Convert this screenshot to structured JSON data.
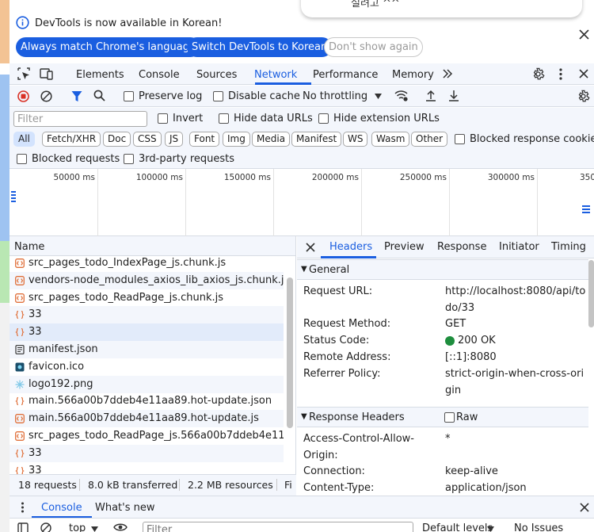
{
  "popup": {
    "text": "설려고 ^^"
  },
  "infobar": {
    "message": "DevTools is now available in Korean!",
    "btn_match": "Always match Chrome's language",
    "btn_switch": "Switch DevTools to Korean",
    "btn_dismiss": "Don't show again"
  },
  "tabs": [
    "Elements",
    "Console",
    "Sources",
    "Network",
    "Performance",
    "Memory"
  ],
  "netbar": {
    "preserve_log": "Preserve log",
    "disable_cache": "Disable cache",
    "throttling": "No throttling"
  },
  "filterbar": {
    "placeholder": "Filter",
    "invert": "Invert",
    "hide_data": "Hide data URLs",
    "hide_ext": "Hide extension URLs"
  },
  "types": [
    "All",
    "Fetch/XHR",
    "Doc",
    "CSS",
    "JS",
    "Font",
    "Img",
    "Media",
    "Manifest",
    "WS",
    "Wasm",
    "Other"
  ],
  "blocked_response": "Blocked response cookies",
  "blockbar": {
    "blocked": "Blocked requests",
    "third_party": "3rd-party requests"
  },
  "overview": {
    "ticks": [
      "50000 ms",
      "100000 ms",
      "150000 ms",
      "200000 ms",
      "250000 ms",
      "300000 ms",
      "350"
    ]
  },
  "requests": {
    "header": "Name",
    "rows": [
      {
        "name": "src_pages_todo_IndexPage_js.chunk.js",
        "icon": "script-icon"
      },
      {
        "name": "vendors-node_modules_axios_lib_axios_js.chunk.js",
        "icon": "script-icon"
      },
      {
        "name": "src_pages_todo_ReadPage_js.chunk.js",
        "icon": "script-icon"
      },
      {
        "name": "33",
        "icon": "fetch-icon"
      },
      {
        "name": "33",
        "icon": "fetch-icon"
      },
      {
        "name": "manifest.json",
        "icon": "document-icon"
      },
      {
        "name": "favicon.ico",
        "icon": "image-icon"
      },
      {
        "name": "logo192.png",
        "icon": "image-icon"
      },
      {
        "name": "main.566a00b7ddeb4e11aa89.hot-update.json",
        "icon": "fetch-icon"
      },
      {
        "name": "main.566a00b7ddeb4e11aa89.hot-update.js",
        "icon": "script-icon"
      },
      {
        "name": "src_pages_todo_ReadPage_js.566a00b7ddeb4e11a...",
        "icon": "script-icon"
      },
      {
        "name": "33",
        "icon": "fetch-icon"
      },
      {
        "name": "33",
        "icon": "fetch-icon"
      }
    ]
  },
  "status": {
    "requests": "18 requests",
    "transferred": "8.0 kB transferred",
    "resources": "2.2 MB resources",
    "finish": "Fi"
  },
  "details": {
    "tabs": [
      "Headers",
      "Preview",
      "Response",
      "Initiator",
      "Timing"
    ],
    "general_title": "General",
    "general": [
      {
        "k": "Request URL:",
        "v": "http://localhost:8080/api/todo/33"
      },
      {
        "k": "Request Method:",
        "v": "GET"
      },
      {
        "k": "Status Code:",
        "v": "200 OK"
      },
      {
        "k": "Remote Address:",
        "v": "[::1]:8080"
      },
      {
        "k": "Referrer Policy:",
        "v": "strict-origin-when-cross-origin"
      }
    ],
    "response_title": "Response Headers",
    "raw": "Raw",
    "response": [
      {
        "k": "Access-Control-Allow-Origin:",
        "v": "*"
      },
      {
        "k": "Connection:",
        "v": "keep-alive"
      },
      {
        "k": "Content-Type:",
        "v": "application/json"
      }
    ],
    "status_color": "#1e8e3e"
  },
  "drawer": {
    "console": "Console",
    "whats_new": "What's new",
    "context": "top",
    "filter_placeholder": "Filter",
    "levels": "Default levels",
    "issues": "No Issues"
  },
  "colors": {
    "accent": "#1a5ee0",
    "record": "#d93025"
  }
}
